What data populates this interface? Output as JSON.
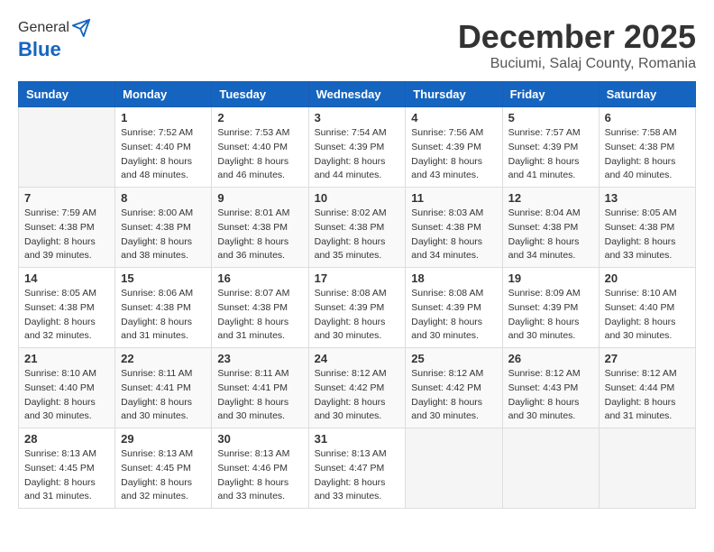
{
  "header": {
    "logo_general": "General",
    "logo_blue": "Blue",
    "month_title": "December 2025",
    "subtitle": "Buciumi, Salaj County, Romania"
  },
  "weekdays": [
    "Sunday",
    "Monday",
    "Tuesday",
    "Wednesday",
    "Thursday",
    "Friday",
    "Saturday"
  ],
  "weeks": [
    [
      {
        "day": "",
        "empty": true
      },
      {
        "day": "1",
        "sunrise": "7:52 AM",
        "sunset": "4:40 PM",
        "daylight": "8 hours and 48 minutes."
      },
      {
        "day": "2",
        "sunrise": "7:53 AM",
        "sunset": "4:40 PM",
        "daylight": "8 hours and 46 minutes."
      },
      {
        "day": "3",
        "sunrise": "7:54 AM",
        "sunset": "4:39 PM",
        "daylight": "8 hours and 44 minutes."
      },
      {
        "day": "4",
        "sunrise": "7:56 AM",
        "sunset": "4:39 PM",
        "daylight": "8 hours and 43 minutes."
      },
      {
        "day": "5",
        "sunrise": "7:57 AM",
        "sunset": "4:39 PM",
        "daylight": "8 hours and 41 minutes."
      },
      {
        "day": "6",
        "sunrise": "7:58 AM",
        "sunset": "4:38 PM",
        "daylight": "8 hours and 40 minutes."
      }
    ],
    [
      {
        "day": "7",
        "sunrise": "7:59 AM",
        "sunset": "4:38 PM",
        "daylight": "8 hours and 39 minutes."
      },
      {
        "day": "8",
        "sunrise": "8:00 AM",
        "sunset": "4:38 PM",
        "daylight": "8 hours and 38 minutes."
      },
      {
        "day": "9",
        "sunrise": "8:01 AM",
        "sunset": "4:38 PM",
        "daylight": "8 hours and 36 minutes."
      },
      {
        "day": "10",
        "sunrise": "8:02 AM",
        "sunset": "4:38 PM",
        "daylight": "8 hours and 35 minutes."
      },
      {
        "day": "11",
        "sunrise": "8:03 AM",
        "sunset": "4:38 PM",
        "daylight": "8 hours and 34 minutes."
      },
      {
        "day": "12",
        "sunrise": "8:04 AM",
        "sunset": "4:38 PM",
        "daylight": "8 hours and 34 minutes."
      },
      {
        "day": "13",
        "sunrise": "8:05 AM",
        "sunset": "4:38 PM",
        "daylight": "8 hours and 33 minutes."
      }
    ],
    [
      {
        "day": "14",
        "sunrise": "8:05 AM",
        "sunset": "4:38 PM",
        "daylight": "8 hours and 32 minutes."
      },
      {
        "day": "15",
        "sunrise": "8:06 AM",
        "sunset": "4:38 PM",
        "daylight": "8 hours and 31 minutes."
      },
      {
        "day": "16",
        "sunrise": "8:07 AM",
        "sunset": "4:38 PM",
        "daylight": "8 hours and 31 minutes."
      },
      {
        "day": "17",
        "sunrise": "8:08 AM",
        "sunset": "4:39 PM",
        "daylight": "8 hours and 30 minutes."
      },
      {
        "day": "18",
        "sunrise": "8:08 AM",
        "sunset": "4:39 PM",
        "daylight": "8 hours and 30 minutes."
      },
      {
        "day": "19",
        "sunrise": "8:09 AM",
        "sunset": "4:39 PM",
        "daylight": "8 hours and 30 minutes."
      },
      {
        "day": "20",
        "sunrise": "8:10 AM",
        "sunset": "4:40 PM",
        "daylight": "8 hours and 30 minutes."
      }
    ],
    [
      {
        "day": "21",
        "sunrise": "8:10 AM",
        "sunset": "4:40 PM",
        "daylight": "8 hours and 30 minutes."
      },
      {
        "day": "22",
        "sunrise": "8:11 AM",
        "sunset": "4:41 PM",
        "daylight": "8 hours and 30 minutes."
      },
      {
        "day": "23",
        "sunrise": "8:11 AM",
        "sunset": "4:41 PM",
        "daylight": "8 hours and 30 minutes."
      },
      {
        "day": "24",
        "sunrise": "8:12 AM",
        "sunset": "4:42 PM",
        "daylight": "8 hours and 30 minutes."
      },
      {
        "day": "25",
        "sunrise": "8:12 AM",
        "sunset": "4:42 PM",
        "daylight": "8 hours and 30 minutes."
      },
      {
        "day": "26",
        "sunrise": "8:12 AM",
        "sunset": "4:43 PM",
        "daylight": "8 hours and 30 minutes."
      },
      {
        "day": "27",
        "sunrise": "8:12 AM",
        "sunset": "4:44 PM",
        "daylight": "8 hours and 31 minutes."
      }
    ],
    [
      {
        "day": "28",
        "sunrise": "8:13 AM",
        "sunset": "4:45 PM",
        "daylight": "8 hours and 31 minutes."
      },
      {
        "day": "29",
        "sunrise": "8:13 AM",
        "sunset": "4:45 PM",
        "daylight": "8 hours and 32 minutes."
      },
      {
        "day": "30",
        "sunrise": "8:13 AM",
        "sunset": "4:46 PM",
        "daylight": "8 hours and 33 minutes."
      },
      {
        "day": "31",
        "sunrise": "8:13 AM",
        "sunset": "4:47 PM",
        "daylight": "8 hours and 33 minutes."
      },
      {
        "day": "",
        "empty": true
      },
      {
        "day": "",
        "empty": true
      },
      {
        "day": "",
        "empty": true
      }
    ]
  ]
}
